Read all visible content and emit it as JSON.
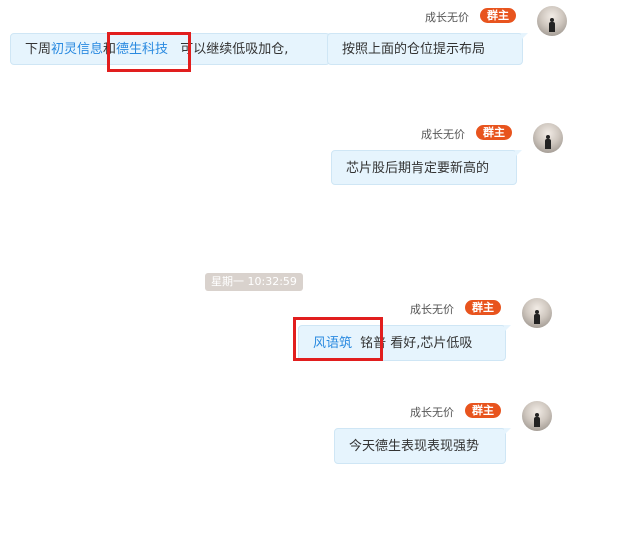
{
  "messages": [
    {
      "sender": "成长无价",
      "role_badge": "群主",
      "first_bubble": {
        "prefix": "下周",
        "link1": "初灵信息",
        "middle": "和",
        "link2": "德生科技",
        "suffix": "可以继续低吸加仓,"
      },
      "text": "按照上面的仓位提示布局"
    },
    {
      "sender": "成长无价",
      "role_badge": "群主",
      "text": "芯片股后期肯定要新高的"
    },
    {
      "sender": "成长无价",
      "role_badge": "群主",
      "link": "风语筑",
      "text": "铭普 看好,芯片低吸"
    },
    {
      "sender": "成长无价",
      "role_badge": "群主",
      "text": "今天德生表现表现强势"
    }
  ],
  "timestamp": "星期一 10:32:59",
  "colors": {
    "bubble_bg": "#e6f4fd",
    "link": "#2a8ae0",
    "badge": "#e8541e",
    "highlight_box": "#e11e1e"
  }
}
